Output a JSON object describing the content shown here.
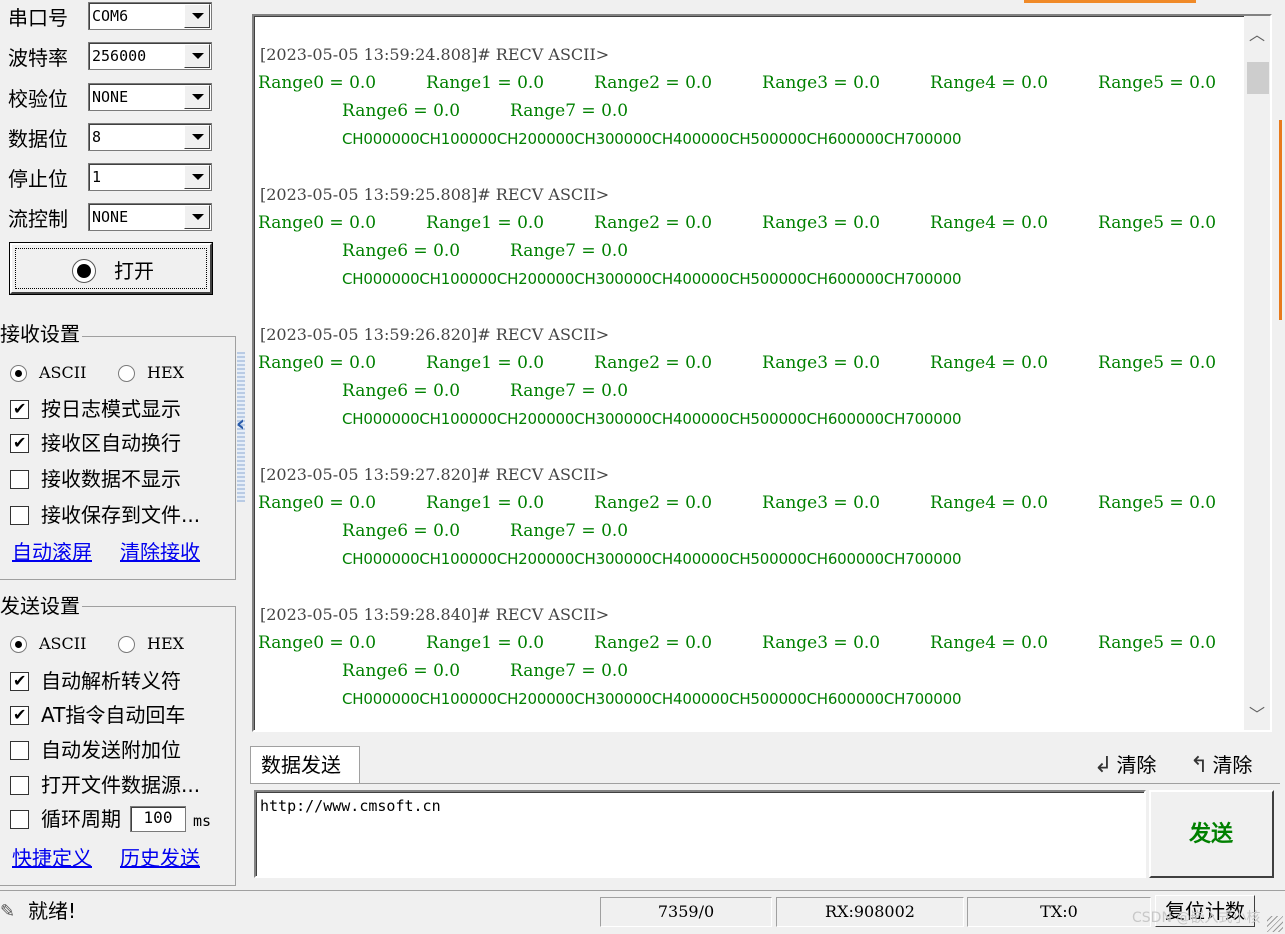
{
  "serial": {
    "rows": [
      {
        "label": "串口号",
        "value": "COM6"
      },
      {
        "label": "波特率",
        "value": "256000"
      },
      {
        "label": "校验位",
        "value": "NONE"
      },
      {
        "label": "数据位",
        "value": "8"
      },
      {
        "label": "停止位",
        "value": "1"
      },
      {
        "label": "流控制",
        "value": "NONE"
      }
    ],
    "open_label": "打开"
  },
  "recv_settings": {
    "title": "接收设置",
    "ascii": "ASCII",
    "hex": "HEX",
    "selected": "ASCII",
    "options": [
      {
        "label": "按日志模式显示",
        "checked": true
      },
      {
        "label": "接收区自动换行",
        "checked": true
      },
      {
        "label": "接收数据不显示",
        "checked": false
      },
      {
        "label": "接收保存到文件...",
        "checked": false
      }
    ],
    "link_autoscroll": "自动滚屏",
    "link_clear": "清除接收"
  },
  "send_settings": {
    "title": "发送设置",
    "ascii": "ASCII",
    "hex": "HEX",
    "selected": "ASCII",
    "options": [
      {
        "label": "自动解析转义符",
        "checked": true
      },
      {
        "label": "AT指令自动回车",
        "checked": true
      },
      {
        "label": "自动发送附加位",
        "checked": false
      },
      {
        "label": "打开文件数据源...",
        "checked": false
      },
      {
        "label": "循环周期",
        "checked": false
      }
    ],
    "cycle_value": "100",
    "cycle_unit": "ms",
    "link_shortcut": "快捷定义",
    "link_history": "历史发送"
  },
  "receive": {
    "entries": [
      {
        "timestamp": "[2023-05-05 13:59:24.808]# RECV ASCII>",
        "ranges": [
          "Range0 = 0.0",
          "Range1 = 0.0",
          "Range2 = 0.0",
          "Range3 = 0.0",
          "Range4 = 0.0",
          "Range5 = 0.0",
          "Range6 = 0.0",
          "Range7 = 0.0"
        ],
        "channels": "CH000000CH100000CH200000CH300000CH400000CH500000CH600000CH700000"
      },
      {
        "timestamp": "[2023-05-05 13:59:25.808]# RECV ASCII>",
        "ranges": [
          "Range0 = 0.0",
          "Range1 = 0.0",
          "Range2 = 0.0",
          "Range3 = 0.0",
          "Range4 = 0.0",
          "Range5 = 0.0",
          "Range6 = 0.0",
          "Range7 = 0.0"
        ],
        "channels": "CH000000CH100000CH200000CH300000CH400000CH500000CH600000CH700000"
      },
      {
        "timestamp": "[2023-05-05 13:59:26.820]# RECV ASCII>",
        "ranges": [
          "Range0 = 0.0",
          "Range1 = 0.0",
          "Range2 = 0.0",
          "Range3 = 0.0",
          "Range4 = 0.0",
          "Range5 = 0.0",
          "Range6 = 0.0",
          "Range7 = 0.0"
        ],
        "channels": "CH000000CH100000CH200000CH300000CH400000CH500000CH600000CH700000"
      },
      {
        "timestamp": "[2023-05-05 13:59:27.820]# RECV ASCII>",
        "ranges": [
          "Range0 = 0.0",
          "Range1 = 0.0",
          "Range2 = 0.0",
          "Range3 = 0.0",
          "Range4 = 0.0",
          "Range5 = 0.0",
          "Range6 = 0.0",
          "Range7 = 0.0"
        ],
        "channels": "CH000000CH100000CH200000CH300000CH400000CH500000CH600000CH700000"
      },
      {
        "timestamp": "[2023-05-05 13:59:28.840]# RECV ASCII>",
        "ranges": [
          "Range0 = 0.0",
          "Range1 = 0.0",
          "Range2 = 0.0",
          "Range3 = 0.0",
          "Range4 = 0.0",
          "Range5 = 0.0",
          "Range6 = 0.0",
          "Range7 = 0.0"
        ],
        "channels": "CH000000CH100000CH200000CH300000CH400000CH500000CH600000CH700000"
      }
    ]
  },
  "send": {
    "tab_label": "数据发送",
    "clear1": "清除",
    "clear2": "清除",
    "input_value": "http://www.cmsoft.cn",
    "send_label": "发送"
  },
  "status": {
    "text": "就绪!",
    "counter": "7359/0",
    "rx": "RX:908002",
    "tx": "TX:0",
    "reset_label": "复位计数",
    "watermark": "CSDN @嵌入式小核"
  },
  "colors": {
    "recv_text": "#008000",
    "link": "#0000ee",
    "accent": "#f08a28"
  }
}
